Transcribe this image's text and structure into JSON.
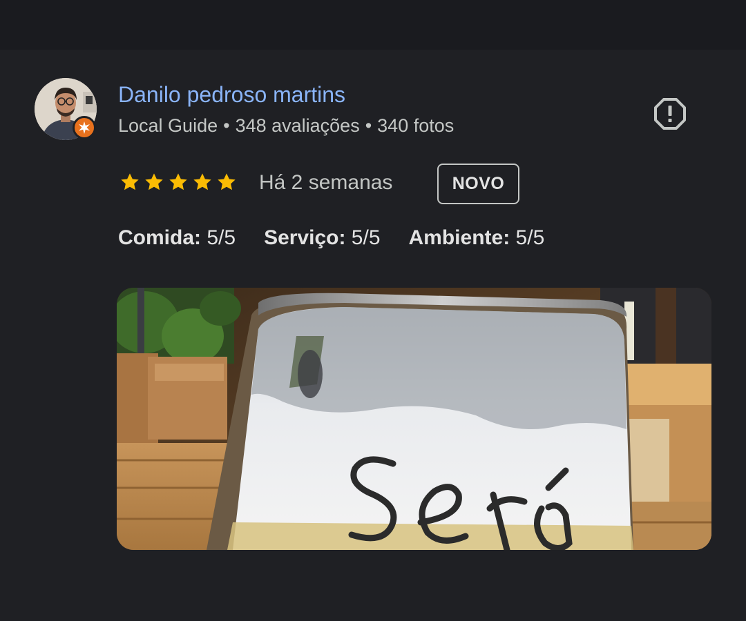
{
  "author": {
    "name": "Danilo pedroso martins",
    "level": "Local Guide",
    "reviews": "348 avaliações",
    "photos": "340 fotos",
    "separator": "•"
  },
  "icons": {
    "report": "report-flag-icon",
    "star": "star-icon",
    "badge": "local-guide-badge-icon"
  },
  "review": {
    "rating": 5,
    "rating_max": 5,
    "date": "Há 2 semanas",
    "badge": "NOVO",
    "subratings": [
      {
        "label": "Comida:",
        "value": "5/5"
      },
      {
        "label": "Serviço:",
        "value": "5/5"
      },
      {
        "label": "Ambiente:",
        "value": "5/5"
      }
    ],
    "photo_text": "Será"
  },
  "colors": {
    "background": "#1f2024",
    "link": "#8ab4f8",
    "star": "#fbbc04",
    "badge_orange": "#e8711d"
  }
}
